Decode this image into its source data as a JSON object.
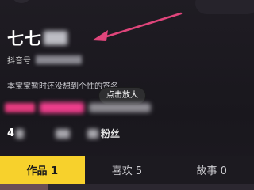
{
  "profile": {
    "name_visible": "七七",
    "id_label": "抖音号",
    "bio": "本宝宝暂时还没想到个性的签名",
    "stats_visible_prefix": "4",
    "fans_label": "粉丝"
  },
  "tooltip": {
    "text": "点击放大"
  },
  "tabs": [
    {
      "label": "作品 1",
      "active": true
    },
    {
      "label": "喜欢 5",
      "active": false
    },
    {
      "label": "故事 0",
      "active": false
    }
  ],
  "colors": {
    "background": "#19171d",
    "active_tab": "#f7d12c",
    "arrow": "#e0457b",
    "tag_pink": "#e33b7e"
  },
  "icons": {
    "annotation": "arrow-pointer-icon"
  }
}
